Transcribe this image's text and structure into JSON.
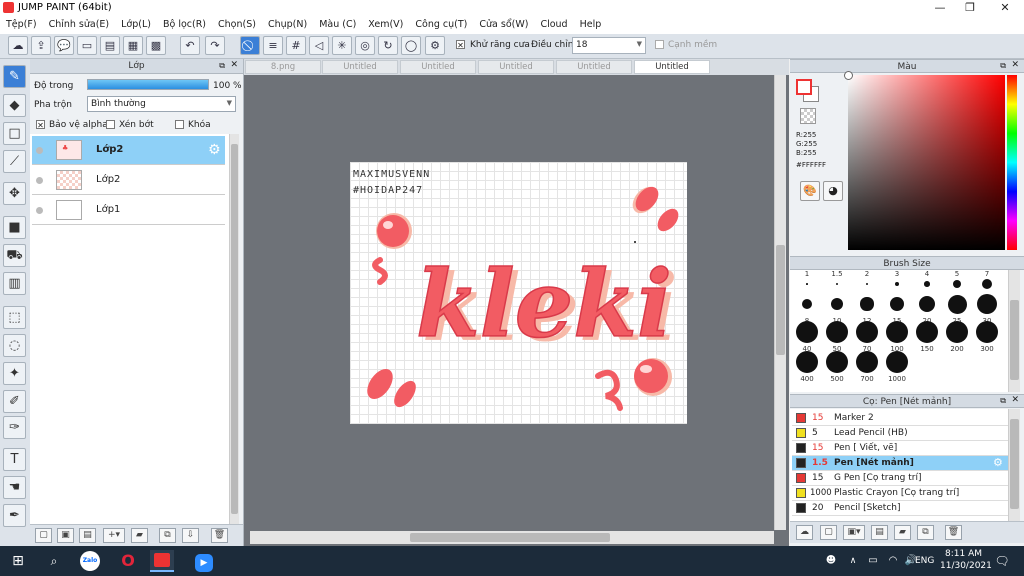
{
  "window": {
    "title": "JUMP PAINT (64bit)"
  },
  "menu": [
    "Tệp(F)",
    "Chỉnh sửa(E)",
    "Lớp(L)",
    "Bộ lọc(R)",
    "Chọn(S)",
    "Chụp(N)",
    "Màu (C)",
    "Xem(V)",
    "Công cụ(T)",
    "Cửa sổ(W)",
    "Cloud",
    "Help"
  ],
  "toolbar": {
    "antialias_label": "Khử răng cưa",
    "adjust_label": "Điều chỉnh",
    "adjust_value": "18",
    "smooth_label": "Cạnh mềm"
  },
  "layer_panel": {
    "title": "Lớp",
    "opacity_label": "Độ trong",
    "opacity_value": "100 %",
    "opacity_fraction": 1.0,
    "blend_label": "Pha trộn",
    "blend_value": "Bình thường",
    "protect_alpha": "Bảo vệ alpha",
    "clipping": "Xén bớt",
    "lock": "Khóa",
    "layers": [
      {
        "name": "Lớp2",
        "selected": true
      },
      {
        "name": "Lớp2",
        "selected": false
      },
      {
        "name": "Lớp1",
        "selected": false
      }
    ]
  },
  "tabs": [
    "8.png",
    "Untitled",
    "Untitled",
    "Untitled",
    "Untitled",
    "Untitled"
  ],
  "active_tab": 5,
  "artwork": {
    "watermark_line1": "MAXIMUSVENN",
    "watermark_line2": "#HOIDAP247",
    "text": "kleki",
    "colors": {
      "main": "#f25c63",
      "shadow": "#f7b9a8",
      "dark": "#d93a4a",
      "highlight": "#ffd6d6"
    }
  },
  "color_panel": {
    "title": "Màu",
    "r": "R:255",
    "g": "G:255",
    "b": "B:255",
    "hex": "#FFFFFF"
  },
  "brush_size_panel": {
    "title": "Brush Size",
    "sizes": [
      "1",
      "1.5",
      "2",
      "3",
      "4",
      "5",
      "7",
      "8",
      "10",
      "12",
      "15",
      "20",
      "25",
      "30",
      "40",
      "50",
      "70",
      "100",
      "150",
      "200",
      "300",
      "400",
      "500",
      "700",
      "1000"
    ]
  },
  "brush_list_panel": {
    "title": "Cọ: Pen [Nét mảnh]",
    "items": [
      {
        "size": "15",
        "name": "Marker 2",
        "color": "#e53935",
        "selected": false
      },
      {
        "size": "5",
        "name": "Lead Pencil (HB)",
        "color": "#f0e020",
        "selected": false
      },
      {
        "size": "15",
        "name": "Pen [ Viết, vẽ]",
        "color": "#222222",
        "selected": false
      },
      {
        "size": "1.5",
        "name": "Pen [Nét mảnh]",
        "color": "#222222",
        "selected": true
      },
      {
        "size": "15",
        "name": "G Pen [Cọ trang trí]",
        "color": "#e53935",
        "selected": false
      },
      {
        "size": "1000",
        "name": "Plastic Crayon [Cọ trang trí]",
        "color": "#f0e020",
        "selected": false
      },
      {
        "size": "20",
        "name": "Pencil [Sketch]",
        "color": "#222222",
        "selected": false
      }
    ]
  },
  "taskbar": {
    "time": "8:11 AM",
    "date": "11/30/2021",
    "lang": "ENG",
    "zalo": "Zalo"
  }
}
